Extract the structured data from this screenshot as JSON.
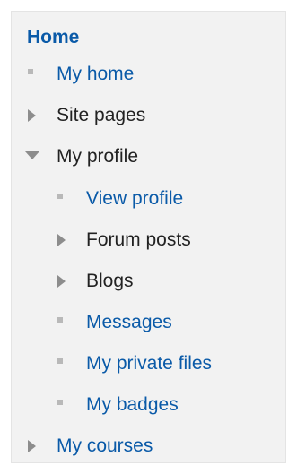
{
  "title": "Home",
  "items": [
    {
      "label": "My home",
      "marker": "bullet",
      "link": true
    },
    {
      "label": "Site pages",
      "marker": "collapsed",
      "link": false
    },
    {
      "label": "My profile",
      "marker": "expanded",
      "link": false
    },
    {
      "label": "View profile",
      "marker": "bullet",
      "link": true
    },
    {
      "label": "Forum posts",
      "marker": "collapsed",
      "link": false
    },
    {
      "label": "Blogs",
      "marker": "collapsed",
      "link": false
    },
    {
      "label": "Messages",
      "marker": "bullet",
      "link": true
    },
    {
      "label": "My private files",
      "marker": "bullet",
      "link": true
    },
    {
      "label": "My badges",
      "marker": "bullet",
      "link": true
    },
    {
      "label": "My courses",
      "marker": "collapsed",
      "link": true
    }
  ],
  "colors": {
    "link": "#0a5aa8",
    "text": "#222222",
    "panel": "#f2f2f2",
    "marker": "#8d8d8d",
    "bullet": "#b9b9b9"
  },
  "icons": {
    "bullet": "bullet-icon",
    "collapsed": "triangle-right-icon",
    "expanded": "triangle-down-icon"
  }
}
